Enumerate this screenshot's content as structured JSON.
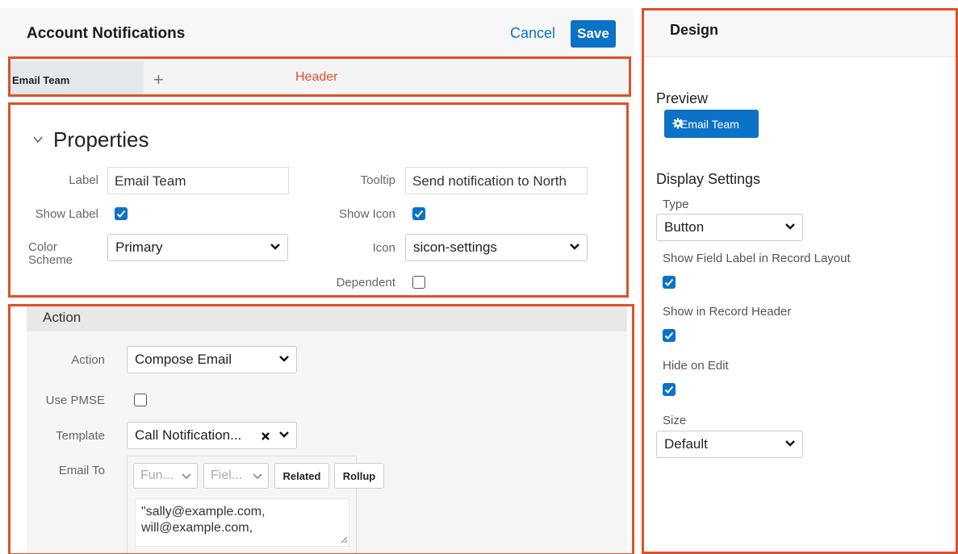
{
  "header": {
    "title": "Account Notifications",
    "cancel_label": "Cancel",
    "save_label": "Save"
  },
  "tabs": {
    "active_label": "Email Team",
    "add_label": "+",
    "section_annotation": "Header"
  },
  "properties": {
    "title": "Properties",
    "label_label": "Label",
    "label_value": "Email Team",
    "tooltip_label": "Tooltip",
    "tooltip_value": "Send notification to North",
    "show_label_label": "Show Label",
    "show_label_checked": true,
    "show_icon_label": "Show Icon",
    "show_icon_checked": true,
    "color_scheme_label": "Color Scheme",
    "color_scheme_value": "Primary",
    "icon_label": "Icon",
    "icon_value": "sicon-settings",
    "dependent_label": "Dependent",
    "dependent_checked": false
  },
  "action": {
    "section_title": "Action",
    "action_label": "Action",
    "action_value": "Compose Email",
    "use_pmse_label": "Use PMSE",
    "use_pmse_checked": false,
    "template_label": "Template",
    "template_value": "Call Notification...",
    "email_to_label": "Email To",
    "function_placeholder": "Fun...",
    "field_placeholder": "Fiel...",
    "related_label": "Related",
    "rollup_label": "Rollup",
    "email_to_value": "\"sally@example.com,\nwill@example.com,"
  },
  "design": {
    "title": "Design",
    "preview_label": "Preview",
    "preview_button_label": "Email Team",
    "display_settings_label": "Display Settings",
    "type_label": "Type",
    "type_value": "Button",
    "show_field_label_label": "Show Field Label in Record Layout",
    "show_field_label_checked": true,
    "show_in_header_label": "Show in Record Header",
    "show_in_header_checked": true,
    "hide_on_edit_label": "Hide on Edit",
    "hide_on_edit_checked": true,
    "size_label": "Size",
    "size_value": "Default"
  },
  "colors": {
    "primary_blue": "#0b72c7",
    "annotation_red": "#e0502a"
  }
}
